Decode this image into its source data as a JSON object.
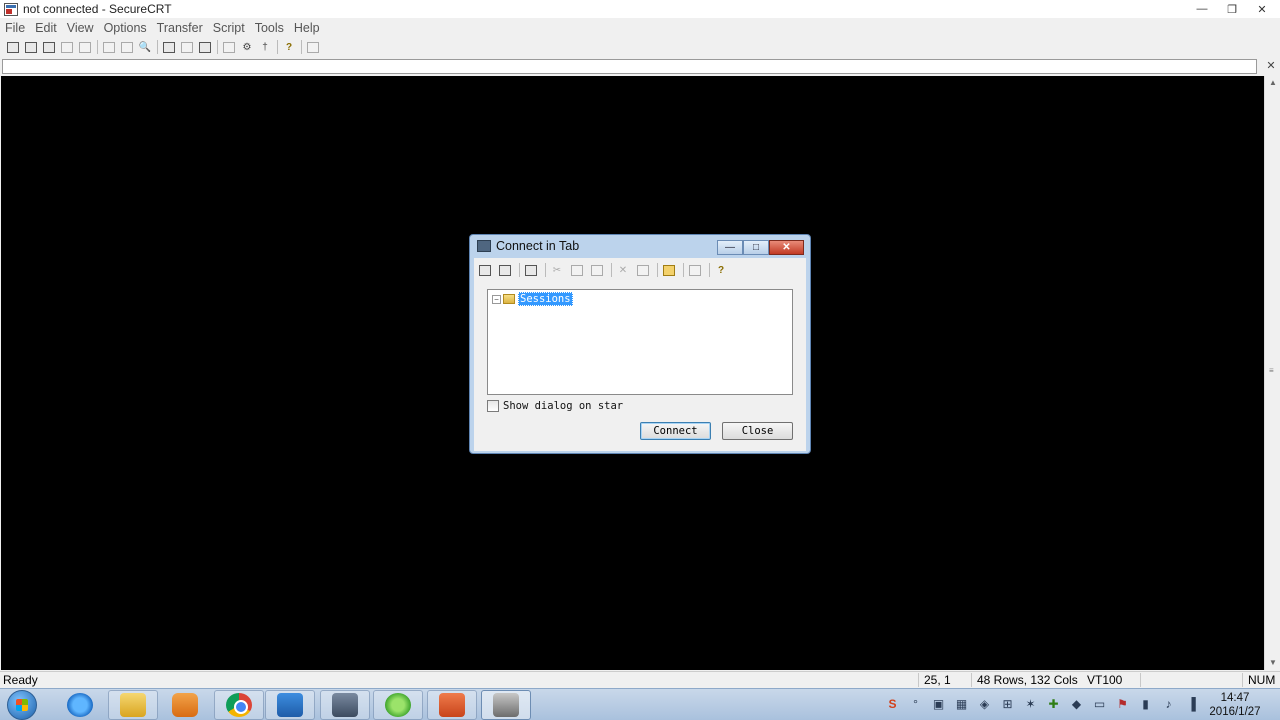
{
  "window": {
    "title": "not connected - SecureCRT",
    "controls": [
      "minimize",
      "restore",
      "close"
    ]
  },
  "menu": [
    "File",
    "Edit",
    "View",
    "Options",
    "Transfer",
    "Script",
    "Tools",
    "Help"
  ],
  "toolbar": {
    "icons": [
      "connect-icon",
      "quick-connect-icon",
      "connect-in-tab-icon",
      "reconnect-icon",
      "disconnect-icon",
      "copy-icon",
      "paste-icon",
      "find-icon",
      "print-icon",
      "print-selection-icon",
      "print-setup-icon",
      "session-options-icon",
      "global-options-icon",
      "keymap-icon",
      "help-icon",
      "sftp-icon"
    ]
  },
  "status": {
    "ready": "Ready",
    "position": "25,  1",
    "size": "48 Rows, 132 Cols",
    "terminal": "VT100",
    "num": "NUM"
  },
  "dialog": {
    "title": "Connect in Tab",
    "tree_root": "Sessions",
    "checkbox_label": "Show dialog on star",
    "checkbox_checked": false,
    "connect_label": "Connect",
    "close_label": "Close"
  },
  "taskbar": {
    "apps": [
      "internet-explorer-icon",
      "file-explorer-icon",
      "media-player-icon",
      "chrome-icon",
      "outlook-icon",
      "lock-app-icon",
      "browser-icon",
      "powerpoint-icon",
      "securecrt-icon"
    ],
    "time": "14:47",
    "date": "2016/1/27"
  }
}
